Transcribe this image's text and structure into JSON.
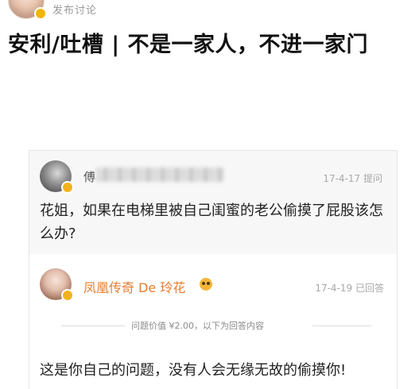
{
  "header": {
    "action_text": "发布讨论"
  },
  "post": {
    "title": "安利/吐槽 | 不是一家人，不进一家门"
  },
  "qa": {
    "question": {
      "asker_name_visible": "傅",
      "date": "17-4-17",
      "status": "提问",
      "text": "花姐，如果在电梯里被自己闺蜜的老公偷摸了屁股该怎么办?"
    },
    "answer": {
      "answerer_name": "凤凰传奇 De 玲花",
      "date": "17-4-19",
      "status": "已回答",
      "divider_text": "问题价值 ¥2.00，以下为回答内容",
      "text": "这是你自己的问题，没有人会无缘无故的偷摸你!"
    }
  },
  "colors": {
    "name_orange": "#ea7b2c",
    "meta_gray": "#a8a8a8",
    "question_bg": "#f7f7f7"
  }
}
